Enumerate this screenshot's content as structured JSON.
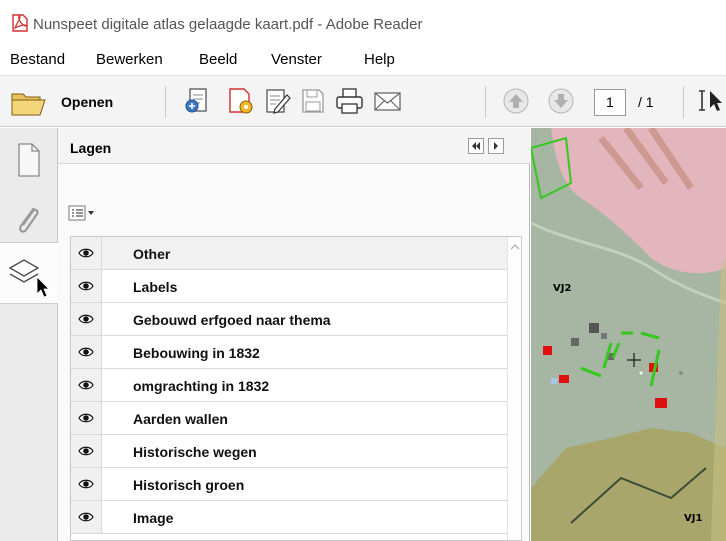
{
  "window": {
    "title": "Nunspeet digitale atlas gelaagde kaart.pdf - Adobe Reader"
  },
  "menu": [
    "Bestand",
    "Bewerken",
    "Beeld",
    "Venster",
    "Help"
  ],
  "toolbar": {
    "open_label": "Openen",
    "page_current": "1",
    "page_total": "/ 1"
  },
  "layers_panel": {
    "title": "Lagen",
    "layers": [
      "Other",
      "Labels",
      "Gebouwd erfgoed naar thema",
      "Bebouwing in 1832",
      "omgrachting in 1832",
      "Aarden wallen",
      "Historische wegen",
      "Historisch groen",
      "Image"
    ]
  },
  "map": {
    "labels": [
      "VJ2",
      "VJ1"
    ]
  },
  "colors": {
    "pdf_red": "#d32f2f",
    "map_green": "#a7b5a3",
    "map_pink": "#e3b5bd",
    "map_olive": "#a8a66a",
    "highlight_green": "#35c81e",
    "building_red": "#e01010"
  }
}
